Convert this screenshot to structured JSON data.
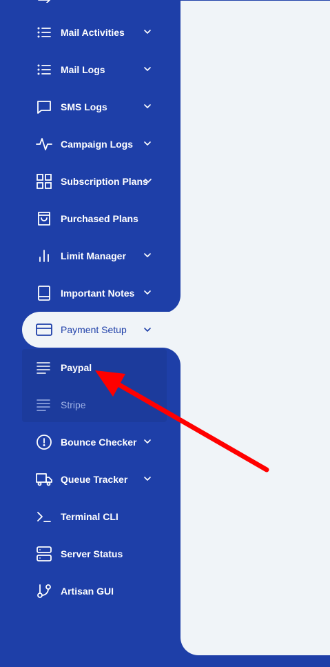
{
  "sidebar": {
    "items": [
      {
        "label": "Mail Activities",
        "icon": "list-icon",
        "has_chevron": true
      },
      {
        "label": "Mail Logs",
        "icon": "list-icon",
        "has_chevron": true
      },
      {
        "label": "SMS Logs",
        "icon": "message-square-icon",
        "has_chevron": true
      },
      {
        "label": "Campaign Logs",
        "icon": "activity-icon",
        "has_chevron": true
      },
      {
        "label": "Subscription Plans",
        "icon": "grid-icon",
        "has_chevron": true
      },
      {
        "label": "Purchased Plans",
        "icon": "shopping-bag-icon",
        "has_chevron": false
      },
      {
        "label": "Limit Manager",
        "icon": "bar-chart-icon",
        "has_chevron": true
      },
      {
        "label": "Important Notes",
        "icon": "book-icon",
        "has_chevron": true
      },
      {
        "label": "Payment Setup",
        "icon": "credit-card-icon",
        "has_chevron": true,
        "active": true
      },
      {
        "label": "Bounce Checker",
        "icon": "alert-circle-icon",
        "has_chevron": true
      },
      {
        "label": "Queue Tracker",
        "icon": "truck-icon",
        "has_chevron": true
      },
      {
        "label": "Terminal CLI",
        "icon": "terminal-icon",
        "has_chevron": false
      },
      {
        "label": "Server Status",
        "icon": "server-icon",
        "has_chevron": false
      },
      {
        "label": "Artisan GUI",
        "icon": "git-branch-icon",
        "has_chevron": false
      }
    ],
    "payment_submenu": [
      {
        "label": "Paypal",
        "icon": "align-left-icon",
        "current": true
      },
      {
        "label": "Stripe",
        "icon": "align-left-icon",
        "current": false
      }
    ]
  },
  "colors": {
    "sidebar_bg": "#1e3fa8",
    "content_bg": "#f0f4f8",
    "submenu_bg": "#1c3b9c",
    "active_text": "#1e3fa8",
    "muted_text": "#9fb2e6",
    "annotation_arrow": "#ff0000"
  }
}
